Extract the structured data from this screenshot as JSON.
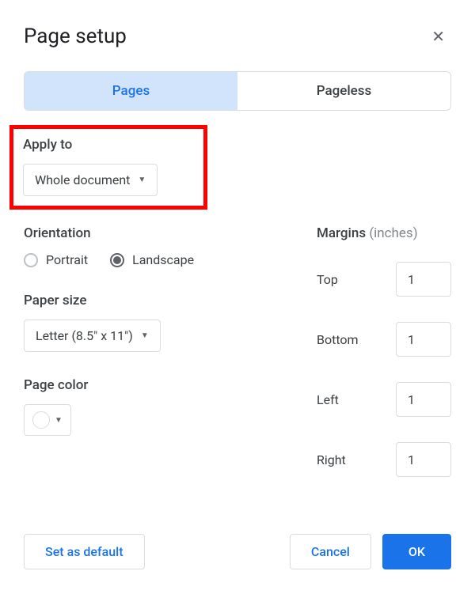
{
  "dialog": {
    "title": "Page setup"
  },
  "tabs": {
    "pages": "Pages",
    "pageless": "Pageless"
  },
  "applyTo": {
    "label": "Apply to",
    "value": "Whole document"
  },
  "orientation": {
    "label": "Orientation",
    "portrait": "Portrait",
    "landscape": "Landscape",
    "selected": "landscape"
  },
  "paperSize": {
    "label": "Paper size",
    "value": "Letter (8.5\" x 11\")"
  },
  "pageColor": {
    "label": "Page color",
    "value": "#ffffff"
  },
  "margins": {
    "label": "Margins",
    "unit": "(inches)",
    "top": {
      "label": "Top",
      "value": "1"
    },
    "bottom": {
      "label": "Bottom",
      "value": "1"
    },
    "left": {
      "label": "Left",
      "value": "1"
    },
    "right": {
      "label": "Right",
      "value": "1"
    }
  },
  "buttons": {
    "setDefault": "Set as default",
    "cancel": "Cancel",
    "ok": "OK"
  }
}
